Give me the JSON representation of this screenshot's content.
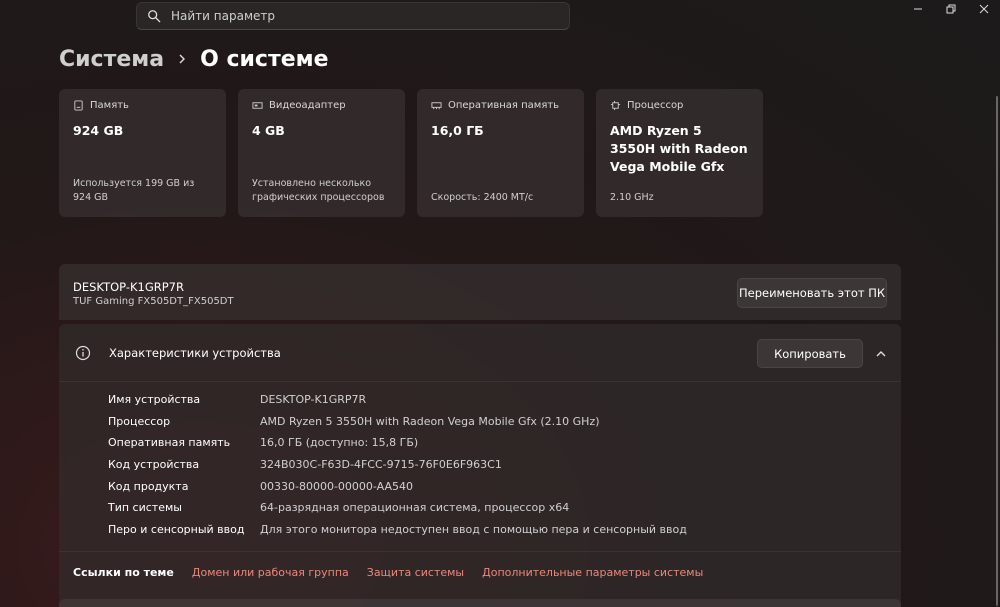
{
  "search": {
    "placeholder": "Найти параметр"
  },
  "breadcrumb": {
    "parent": "Система",
    "current": "О системе"
  },
  "cards": [
    {
      "title": "Память",
      "value": "924 GB",
      "sub": "Используется 199 GB из 924 GB",
      "icon": "storage-icon"
    },
    {
      "title": "Видеоадаптер",
      "value": "4 GB",
      "sub": "Установлено несколько графических процессоров",
      "icon": "gpu-icon"
    },
    {
      "title": "Оперативная память",
      "value": "16,0 ГБ",
      "sub": "Скорость: 2400 MT/с",
      "icon": "ram-icon"
    },
    {
      "title": "Процессор",
      "value": "AMD Ryzen 5 3550H with Radeon Vega Mobile Gfx",
      "sub": "2.10 GHz",
      "icon": "cpu-icon"
    }
  ],
  "device": {
    "name": "DESKTOP-K1GRP7R",
    "model": "TUF Gaming FX505DT_FX505DT",
    "rename_label": "Переименовать этот ПК"
  },
  "specs": {
    "title": "Характеристики устройства",
    "copy_label": "Копировать",
    "rows": [
      {
        "label": "Имя устройства",
        "value": "DESKTOP-K1GRP7R"
      },
      {
        "label": "Процессор",
        "value": "AMD Ryzen 5 3550H with Radeon Vega Mobile Gfx   (2.10 GHz)"
      },
      {
        "label": "Оперативная память",
        "value": "16,0 ГБ (доступно: 15,8 ГБ)"
      },
      {
        "label": "Код устройства",
        "value": "324B030C-F63D-4FCC-9715-76F0E6F963C1"
      },
      {
        "label": "Код продукта",
        "value": "00330-80000-00000-AA540"
      },
      {
        "label": "Тип системы",
        "value": "64-разрядная операционная система, процессор x64"
      },
      {
        "label": "Перо и сенсорный ввод",
        "value": "Для этого монитора недоступен ввод с помощью пера и сенсорный ввод"
      }
    ]
  },
  "links": {
    "title": "Ссылки по теме",
    "items": [
      "Домен или рабочая группа",
      "Защита системы",
      "Дополнительные параметры системы"
    ]
  },
  "colors": {
    "accent_link": "#e9897a"
  }
}
